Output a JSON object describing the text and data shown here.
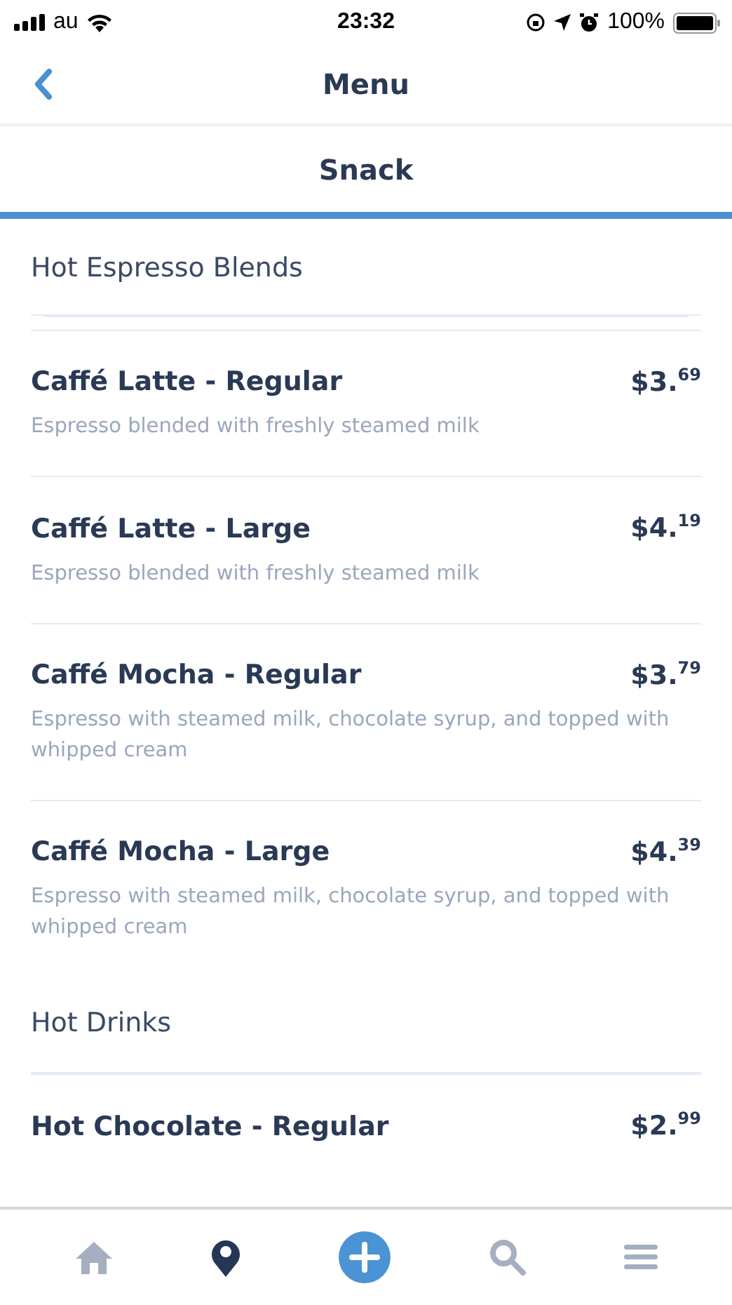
{
  "status_bar": {
    "carrier": "au",
    "time": "23:32",
    "battery": "100%"
  },
  "nav": {
    "title": "Menu"
  },
  "category_tab": {
    "label": "Snack",
    "selected": true
  },
  "menu": [
    {
      "kind": "section",
      "title": "Hot Espresso Blends"
    },
    {
      "kind": "item",
      "name": "Caffé Latte - Regular",
      "price": "$3.$^{69}$",
      "description": "Espresso blended with freshly steamed milk"
    },
    {
      "kind": "item",
      "name": "Caffé Latte - Large",
      "price": "$4.$^{19}$",
      "description": "Espresso blended with freshly steamed milk"
    },
    {
      "kind": "item",
      "name": "Caffé Mocha - Regular",
      "price": "$3.$^{79}$",
      "description": "Espresso with steamed milk, chocolate syrup, and topped with whipped cream"
    },
    {
      "kind": "item",
      "name": "Caffé Mocha - Large",
      "price": "$4.$^{39}$",
      "description": "Espresso with steamed milk, chocolate syrup, and topped with whipped cream"
    },
    {
      "kind": "section",
      "title": "Hot Drinks"
    },
    {
      "kind": "item",
      "name": "Hot Chocolate - Regular",
      "price": "$2.$^{99}$"
    }
  ],
  "tab_bar": [
    {
      "kind": "home",
      "selected": false
    },
    {
      "kind": "location",
      "selected": true
    },
    {
      "kind": "add",
      "selected": false
    },
    {
      "kind": "search",
      "selected": false
    },
    {
      "kind": "menu",
      "selected": false
    }
  ]
}
